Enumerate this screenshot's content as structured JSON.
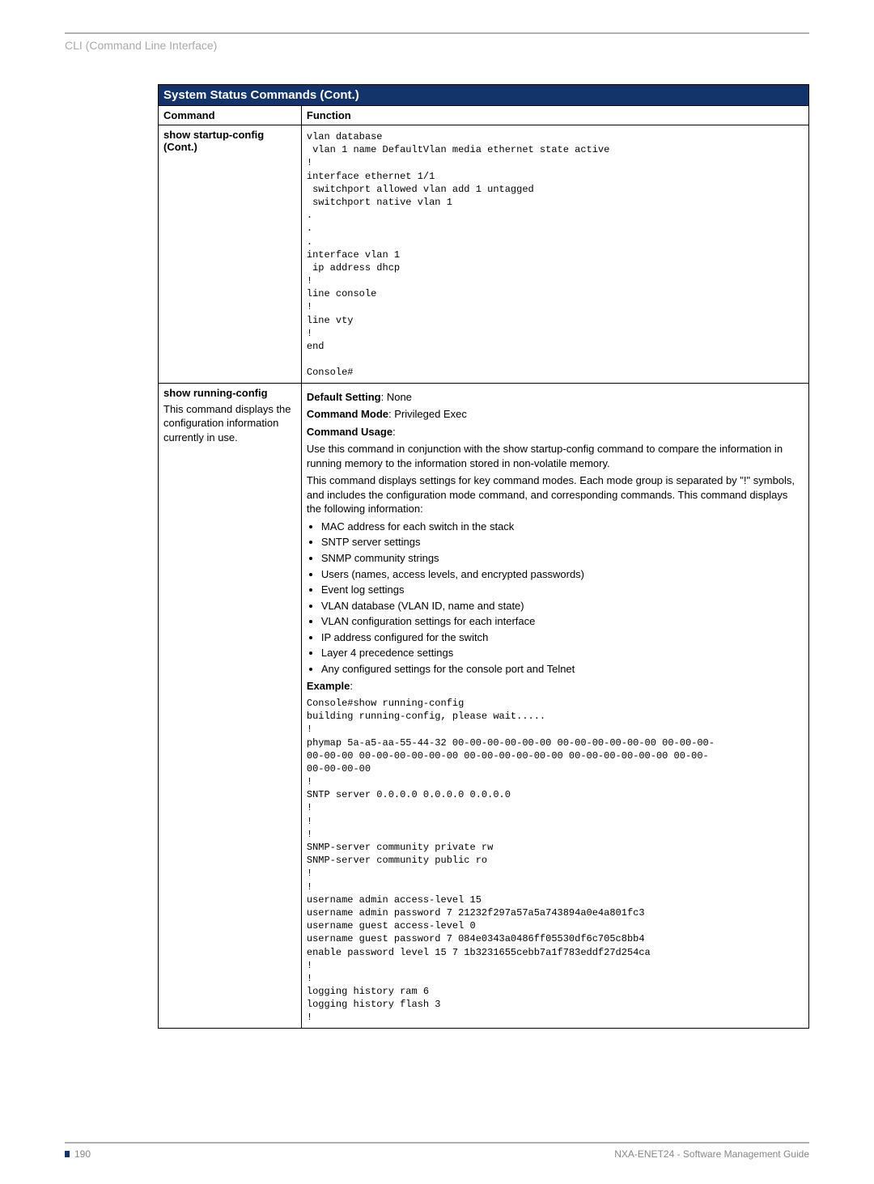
{
  "breadcrumb": "CLI (Command Line Interface)",
  "table": {
    "title": "System Status Commands (Cont.)",
    "headers": {
      "command": "Command",
      "function": "Function"
    },
    "row1": {
      "command_line1": "show startup-config",
      "command_line2": "(Cont.)",
      "code": "vlan database\n vlan 1 name DefaultVlan media ethernet state active\n!\ninterface ethernet 1/1\n switchport allowed vlan add 1 untagged\n switchport native vlan 1\n.\n.\n.\ninterface vlan 1\n ip address dhcp\n!\nline console\n!\nline vty\n!\nend\n\nConsole#"
    },
    "row2": {
      "command_name": "show running-config",
      "command_desc": "This command displays the configuration information currently in use.",
      "default_label": "Default Setting",
      "default_value": ": None",
      "mode_label": "Command Mode",
      "mode_value": ": Privileged Exec",
      "usage_label": "Command Usage",
      "usage_colon": ":",
      "usage_p1": "Use this command in conjunction with the show startup-config command to compare the information in running memory to the information stored in non-volatile memory.",
      "usage_p2": "This command displays settings for key command modes. Each mode group is separated by \"!\" symbols, and includes the configuration mode command, and corresponding commands. This command displays the following information:",
      "bullets": [
        "MAC address for each switch in the stack",
        "SNTP server settings",
        "SNMP community strings",
        "Users (names, access levels, and encrypted passwords)",
        "Event log settings",
        "VLAN database (VLAN ID, name and state)",
        "VLAN configuration settings for each interface",
        "IP address configured for the switch",
        "Layer 4 precedence settings",
        "Any configured settings for the console port and Telnet"
      ],
      "example_label": "Example",
      "example_colon": ":",
      "example_code": "Console#show running-config\nbuilding running-config, please wait.....\n!\nphymap 5a-a5-aa-55-44-32 00-00-00-00-00-00 00-00-00-00-00-00 00-00-00-\n00-00-00 00-00-00-00-00-00 00-00-00-00-00-00 00-00-00-00-00-00 00-00-\n00-00-00-00\n!\nSNTP server 0.0.0.0 0.0.0.0 0.0.0.0\n!\n!\n!\nSNMP-server community private rw\nSNMP-server community public ro\n!\n!\nusername admin access-level 15\nusername admin password 7 21232f297a57a5a743894a0e4a801fc3\nusername guest access-level 0\nusername guest password 7 084e0343a0486ff05530df6c705c8bb4\nenable password level 15 7 1b3231655cebb7a1f783eddf27d254ca\n!\n!\nlogging history ram 6\nlogging history flash 3\n!"
    }
  },
  "footer": {
    "page": "190",
    "doc": "NXA-ENET24 - Software Management Guide"
  }
}
